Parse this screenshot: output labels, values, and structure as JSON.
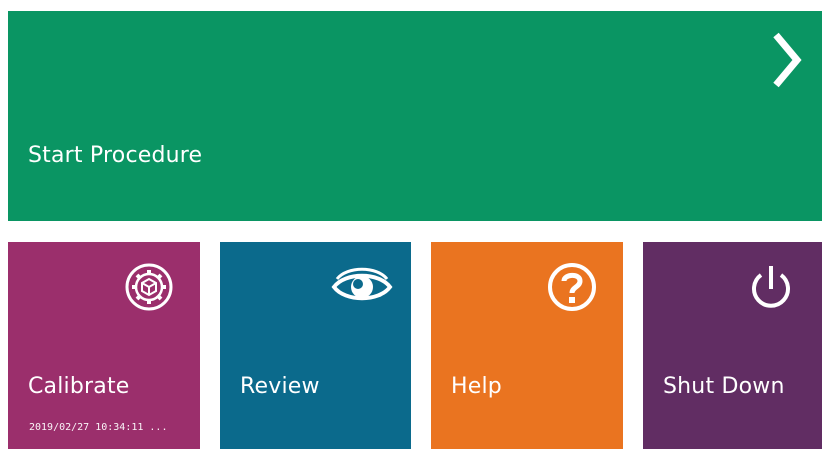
{
  "tiles": {
    "start": {
      "label": "Start Procedure",
      "color": "#0a9563",
      "icon": "chevron-right-icon"
    },
    "calibrate": {
      "label": "Calibrate",
      "sublabel": "2019/02/27 10:34:11 ...",
      "color": "#9b2f6c",
      "icon": "calibrate-gear-icon"
    },
    "review": {
      "label": "Review",
      "color": "#0b6a8c",
      "icon": "eye-icon"
    },
    "help": {
      "label": "Help",
      "color": "#ea7420",
      "icon": "question-mark-icon"
    },
    "shutdown": {
      "label": "Shut Down",
      "color": "#612d63",
      "icon": "power-icon"
    }
  }
}
